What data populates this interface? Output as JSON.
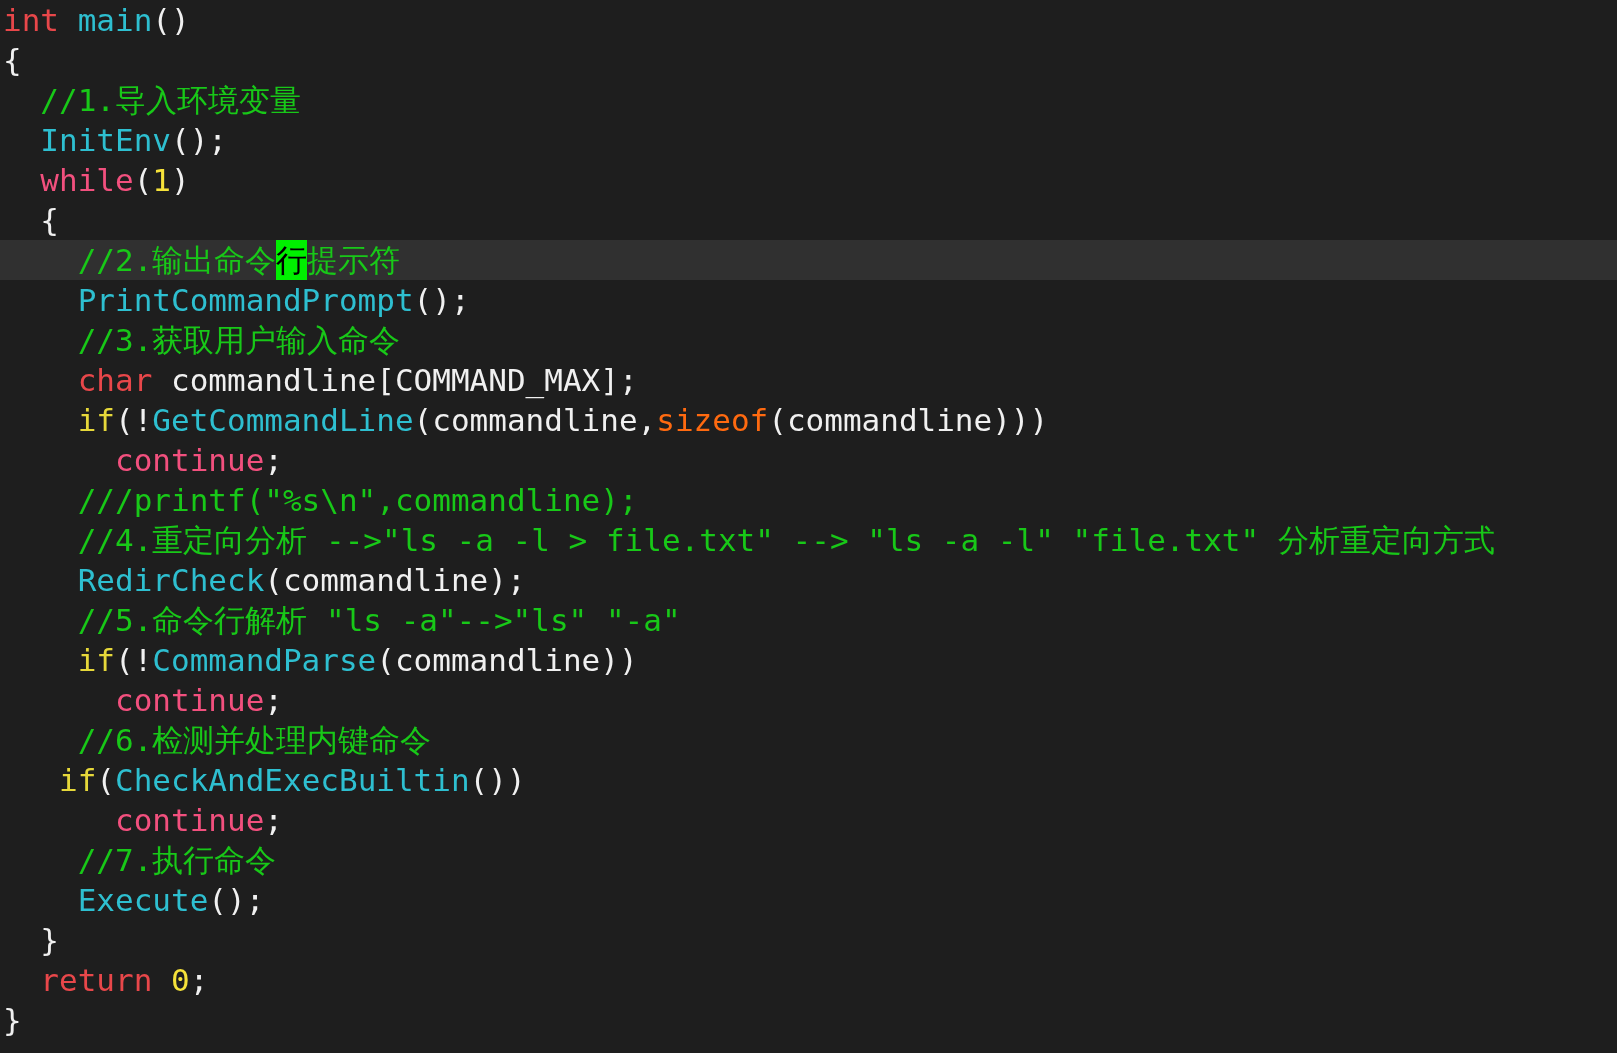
{
  "editor": {
    "lines": [
      {
        "current": false,
        "tokens": [
          {
            "kind": "type",
            "text": "int"
          },
          {
            "kind": "func",
            "text": " main"
          },
          {
            "kind": "plain",
            "text": "()"
          }
        ]
      },
      {
        "current": false,
        "tokens": [
          {
            "kind": "plain",
            "text": "{"
          }
        ]
      },
      {
        "current": false,
        "tokens": [
          {
            "kind": "comment",
            "text": "  //1.导入环境变量"
          }
        ]
      },
      {
        "current": false,
        "tokens": [
          {
            "kind": "func",
            "text": "  InitEnv"
          },
          {
            "kind": "plain",
            "text": "();"
          }
        ]
      },
      {
        "current": false,
        "tokens": [
          {
            "kind": "loop",
            "text": "  while"
          },
          {
            "kind": "plain",
            "text": "("
          },
          {
            "kind": "number",
            "text": "1"
          },
          {
            "kind": "plain",
            "text": ")"
          }
        ]
      },
      {
        "current": false,
        "tokens": [
          {
            "kind": "plain",
            "text": "  {"
          }
        ]
      },
      {
        "current": true,
        "tokens": [
          {
            "kind": "comment",
            "text": "    //2.输出命令"
          },
          {
            "kind": "cursor",
            "text": "行"
          },
          {
            "kind": "comment",
            "text": "提示符"
          }
        ]
      },
      {
        "current": false,
        "tokens": [
          {
            "kind": "func",
            "text": "    PrintCommandPrompt"
          },
          {
            "kind": "plain",
            "text": "();"
          }
        ]
      },
      {
        "current": false,
        "tokens": [
          {
            "kind": "comment",
            "text": "    //3.获取用户输入命令"
          }
        ]
      },
      {
        "current": false,
        "tokens": [
          {
            "kind": "type",
            "text": "    char"
          },
          {
            "kind": "plain",
            "text": " commandline[COMMAND_MAX];"
          }
        ]
      },
      {
        "current": false,
        "tokens": [
          {
            "kind": "control",
            "text": "    if"
          },
          {
            "kind": "plain",
            "text": "(!"
          },
          {
            "kind": "func",
            "text": "GetCommandLine"
          },
          {
            "kind": "plain",
            "text": "(commandline,"
          },
          {
            "kind": "operator",
            "text": "sizeof"
          },
          {
            "kind": "plain",
            "text": "(commandline)))"
          }
        ]
      },
      {
        "current": false,
        "tokens": [
          {
            "kind": "loop",
            "text": "      continue"
          },
          {
            "kind": "plain",
            "text": ";"
          }
        ]
      },
      {
        "current": false,
        "tokens": [
          {
            "kind": "comment",
            "text": "    ///printf(\"%s\\n\",commandline);"
          }
        ]
      },
      {
        "current": false,
        "tokens": [
          {
            "kind": "comment",
            "text": "    //4.重定向分析 -->\"ls -a -l > file.txt\" --> \"ls -a -l\" \"file.txt\" 分析重定向方式"
          }
        ]
      },
      {
        "current": false,
        "tokens": [
          {
            "kind": "func",
            "text": "    RedirCheck"
          },
          {
            "kind": "plain",
            "text": "(commandline);"
          }
        ]
      },
      {
        "current": false,
        "tokens": [
          {
            "kind": "comment",
            "text": "    //5.命令行解析 \"ls -a\"-->\"ls\" \"-a\""
          }
        ]
      },
      {
        "current": false,
        "tokens": [
          {
            "kind": "control",
            "text": "    if"
          },
          {
            "kind": "plain",
            "text": "(!"
          },
          {
            "kind": "func",
            "text": "CommandParse"
          },
          {
            "kind": "plain",
            "text": "(commandline))"
          }
        ]
      },
      {
        "current": false,
        "tokens": [
          {
            "kind": "loop",
            "text": "      continue"
          },
          {
            "kind": "plain",
            "text": ";"
          }
        ]
      },
      {
        "current": false,
        "tokens": [
          {
            "kind": "comment",
            "text": "    //6.检测并处理内键命令"
          }
        ]
      },
      {
        "current": false,
        "tokens": [
          {
            "kind": "control",
            "text": "   if"
          },
          {
            "kind": "plain",
            "text": "("
          },
          {
            "kind": "func",
            "text": "CheckAndExecBuiltin"
          },
          {
            "kind": "plain",
            "text": "())"
          }
        ]
      },
      {
        "current": false,
        "tokens": [
          {
            "kind": "loop",
            "text": "      continue"
          },
          {
            "kind": "plain",
            "text": ";"
          }
        ]
      },
      {
        "current": false,
        "tokens": [
          {
            "kind": "comment",
            "text": "    //7.执行命令"
          }
        ]
      },
      {
        "current": false,
        "tokens": [
          {
            "kind": "func",
            "text": "    Execute"
          },
          {
            "kind": "plain",
            "text": "();"
          }
        ]
      },
      {
        "current": false,
        "tokens": [
          {
            "kind": "plain",
            "text": "  }"
          }
        ]
      },
      {
        "current": false,
        "tokens": [
          {
            "kind": "type",
            "text": "  return "
          },
          {
            "kind": "number",
            "text": "0"
          },
          {
            "kind": "plain",
            "text": ";"
          }
        ]
      },
      {
        "current": false,
        "tokens": [
          {
            "kind": "plain",
            "text": "}"
          }
        ]
      }
    ]
  }
}
